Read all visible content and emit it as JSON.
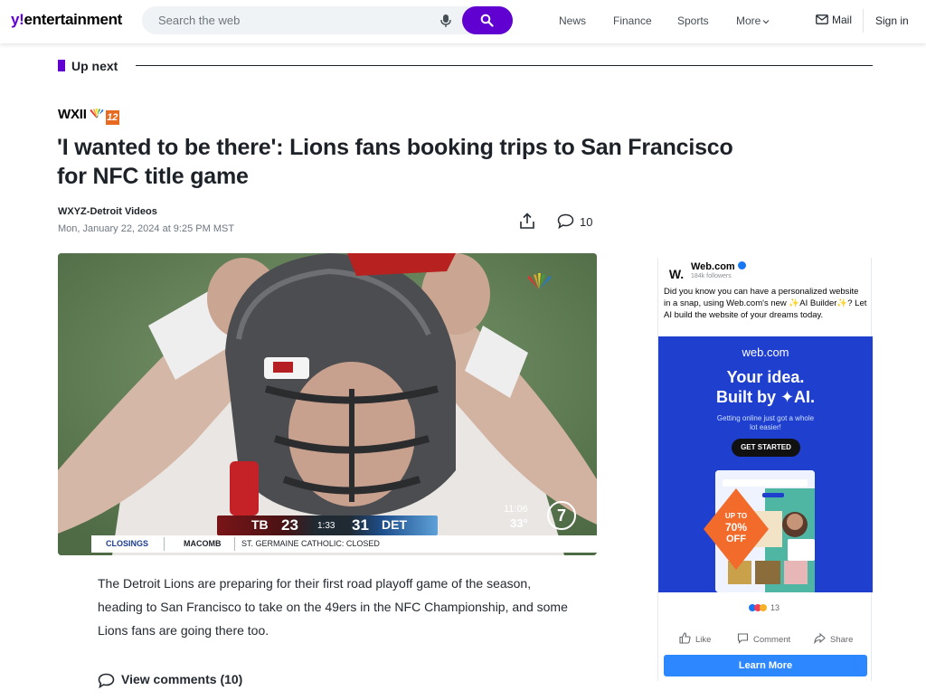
{
  "header": {
    "logo_prefix": "y",
    "logo_bang": "!",
    "logo_word": "entertainment",
    "search_placeholder": "Search the web",
    "nav": [
      "News",
      "Finance",
      "Sports",
      "More"
    ],
    "mail": "Mail",
    "signin": "Sign in",
    "accent_color": "#6001d2"
  },
  "upnext": {
    "label": "Up next"
  },
  "article": {
    "source_logo": "WXII",
    "source_logo_number": "12",
    "headline": "'I wanted to be there': Lions fans booking trips to San Francisco for NFC title game",
    "author": "WXYZ-Detroit Videos",
    "date": "Mon, January 22, 2024 at 9:25 PM MST",
    "comment_count": "10",
    "body": "The Detroit Lions are preparing for their first road playoff game of the season, heading to San Francisco to take on the 49ers in the NFC Championship, and some Lions fans are going there too.",
    "view_comments": "View comments (10)"
  },
  "video": {
    "score_home_team": "TB",
    "score_home": "23",
    "score_clock": "1:33",
    "score_away": "31",
    "score_away_team": "DET",
    "weather_time": "11:06",
    "weather_temp": "33°",
    "channel": "7",
    "ticker_label": "CLOSINGS",
    "ticker_location": "MACOMB",
    "ticker_text": "ST. GERMAINE CATHOLIC: CLOSED"
  },
  "ad": {
    "advertiser": "Web.com",
    "avatar_letter": "W.",
    "followers": "184k followers",
    "copy": "Did you know you can have a personalized website in a snap, using Web.com's new ✨AI Builder✨? Let AI build the website of your dreams today.",
    "brand": "web.com",
    "headline_1": "Your idea.",
    "headline_2": "Built by ✦AI.",
    "subtext": "Getting online just got a whole lot easier!",
    "cta": "GET STARTED",
    "badge_1": "UP TO",
    "badge_2": "70%",
    "badge_3": "OFF",
    "reactions": "13",
    "like": "Like",
    "comment": "Comment",
    "share": "Share",
    "learn_more": "Learn More"
  }
}
